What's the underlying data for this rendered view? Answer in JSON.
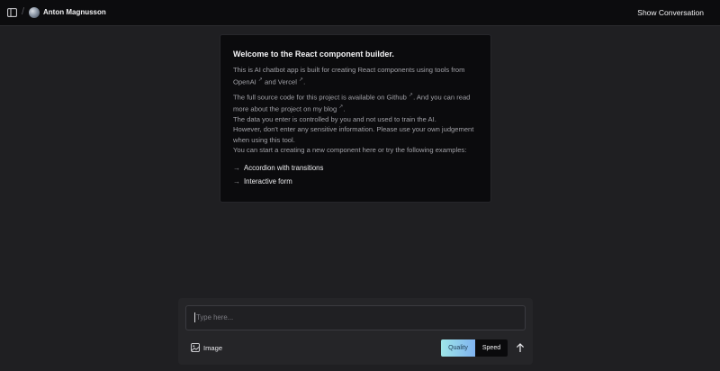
{
  "header": {
    "separator": "/",
    "user_name": "Anton Magnusson",
    "show_conversation_label": "Show Conversation"
  },
  "welcome": {
    "title": "Welcome to the React component builder.",
    "intro_prefix": "This is AI chatbot app is built for creating React components using tools from OpenAI",
    "intro_mid": " and Vercel",
    "intro_suffix": ".",
    "source_prefix": "The full source code for this project is available on Github",
    "source_mid": ". And you can read more about the project on my blog",
    "source_suffix": ".",
    "data_notice": "The data you enter is controlled by you and not used to train the AI.",
    "sensitive_notice": "However, don't enter any sensitive information. Please use your own judgement when using this tool.",
    "start_text": "You can start a creating a new component here or try the following examples:",
    "external_link_glyph": "↗",
    "examples": [
      {
        "arrow": "→",
        "label": "Accordion with transitions"
      },
      {
        "arrow": "→",
        "label": "Interactive form"
      }
    ]
  },
  "composer": {
    "input_placeholder": "Type here...",
    "input_value": "",
    "image_button_label": "Image",
    "image_icon": "image-icon",
    "mode_options": [
      "Quality",
      "Speed"
    ],
    "mode_selected": "Quality",
    "send_icon": "arrow-up-icon"
  },
  "icons": {
    "sidebar_toggle": "sidebar-toggle-icon",
    "avatar": "avatar"
  },
  "colors": {
    "background": "#1f1f22",
    "header_bg": "#0c0c0e",
    "card_bg": "#0b0b0d",
    "quality_gradient_start": "#9ee6e8",
    "quality_gradient_end": "#7fb3f0",
    "speed_bg": "#0a0a0c"
  }
}
